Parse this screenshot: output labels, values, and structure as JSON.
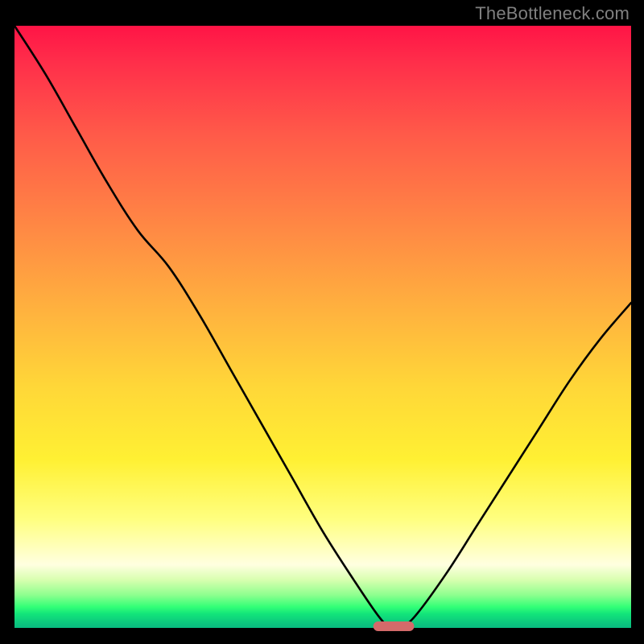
{
  "attribution": "TheBottleneck.com",
  "colors": {
    "frame": "#000000",
    "attribution_text": "#808080",
    "curve": "#000000",
    "marker": "#d46a6a",
    "gradient_top": "#ff1446",
    "gradient_bottom": "#09bb80"
  },
  "chart_data": {
    "type": "line",
    "title": "",
    "xlabel": "",
    "ylabel": "",
    "xlim": [
      0,
      100
    ],
    "ylim": [
      0,
      100
    ],
    "grid": false,
    "legend": false,
    "x": [
      0,
      5,
      10,
      15,
      20,
      25,
      30,
      35,
      40,
      45,
      50,
      55,
      59,
      61,
      62.5,
      65,
      70,
      75,
      80,
      85,
      90,
      95,
      100
    ],
    "values": [
      100,
      92,
      83,
      74,
      66,
      60,
      52,
      43,
      34,
      25,
      16,
      8,
      2,
      0,
      0,
      2,
      9,
      17,
      25,
      33,
      41,
      48,
      54
    ],
    "marker": {
      "x": 61.5,
      "y": 0,
      "width_x": 6.5
    }
  }
}
